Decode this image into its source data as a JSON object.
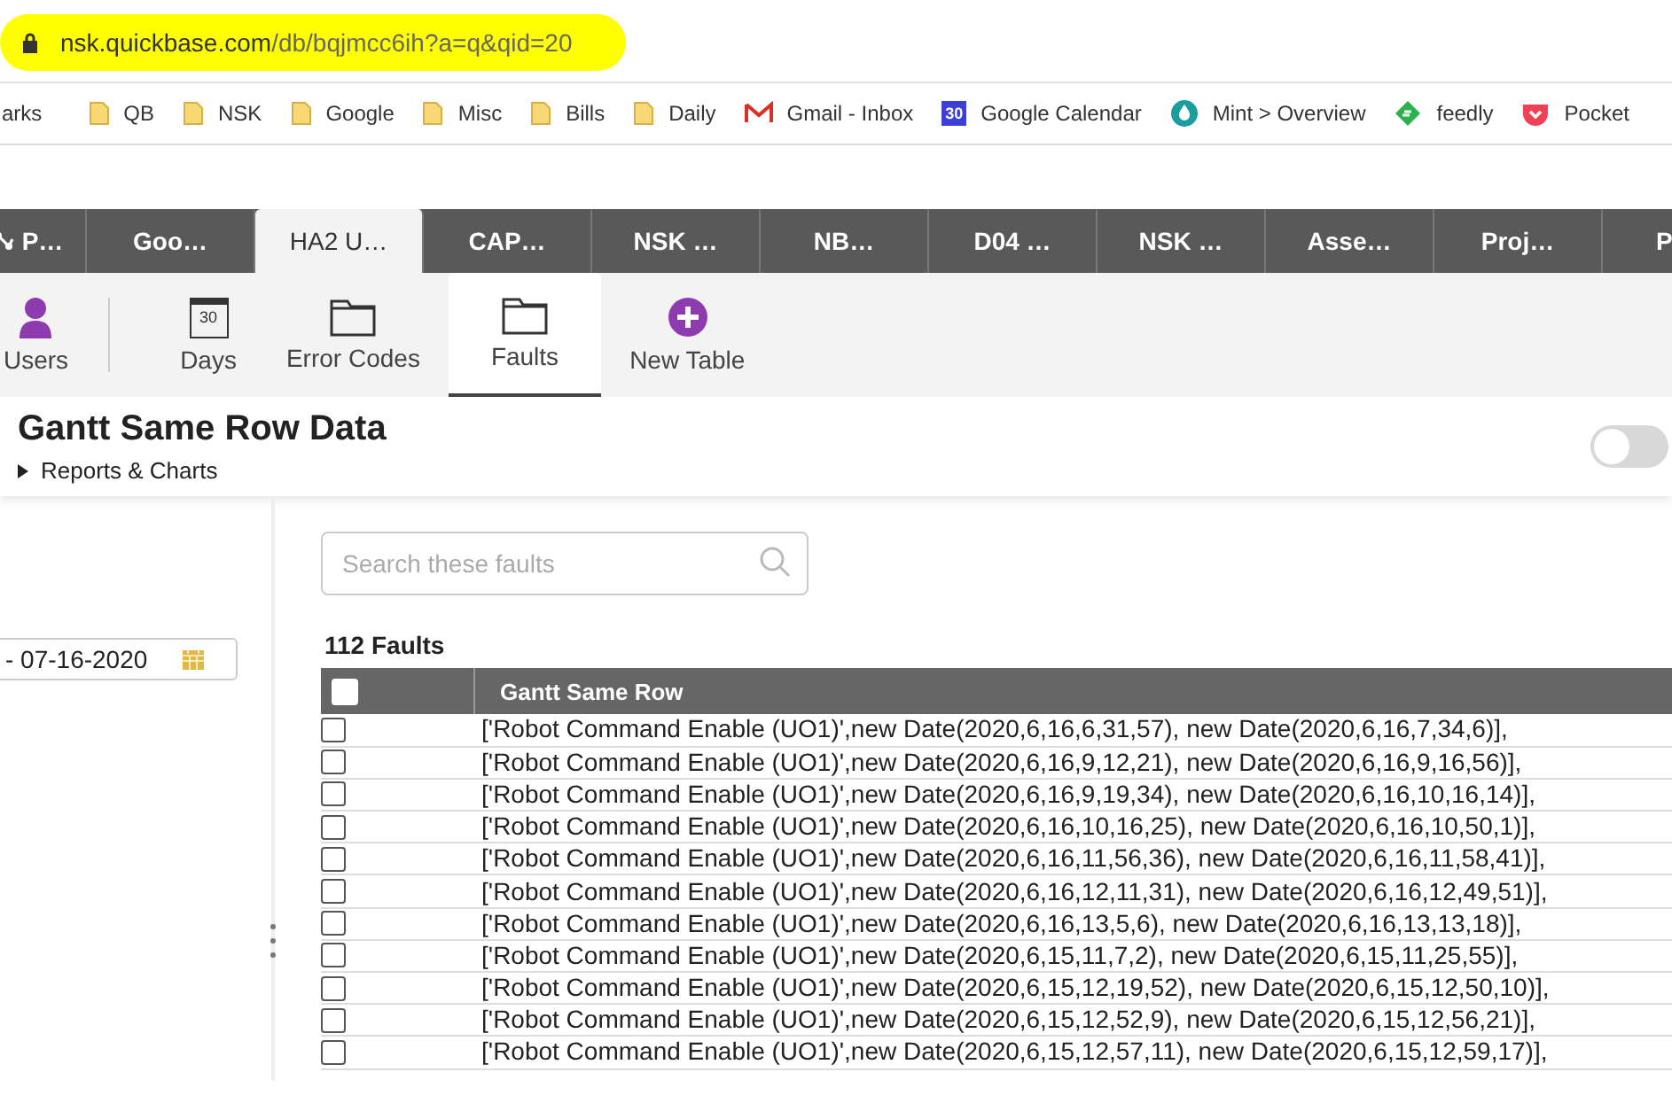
{
  "address_bar": {
    "host": "nsk.quickbase.com",
    "path": "/db/bqjmcc6ih?a=q&qid=20",
    "highlighted": true
  },
  "bookmarks": [
    {
      "label": "arks",
      "kind": "text"
    },
    {
      "label": "QB",
      "kind": "folder"
    },
    {
      "label": "NSK",
      "kind": "folder"
    },
    {
      "label": "Google",
      "kind": "folder"
    },
    {
      "label": "Misc",
      "kind": "folder"
    },
    {
      "label": "Bills",
      "kind": "folder"
    },
    {
      "label": "Daily",
      "kind": "folder"
    },
    {
      "label": "Gmail - Inbox",
      "kind": "mail"
    },
    {
      "label": "Google Calendar",
      "kind": "calendar",
      "icon_text": "30"
    },
    {
      "label": "Mint > Overview",
      "kind": "drop"
    },
    {
      "label": "feedly",
      "kind": "feed"
    },
    {
      "label": "Pocket",
      "kind": "pocket"
    }
  ],
  "app_tabs": [
    {
      "label": "P…",
      "selected": false,
      "kind": "app"
    },
    {
      "label": "Goo…",
      "selected": false
    },
    {
      "label": "HA2 U…",
      "selected": true
    },
    {
      "label": "CAP…",
      "selected": false
    },
    {
      "label": "NSK …",
      "selected": false
    },
    {
      "label": "NB…",
      "selected": false
    },
    {
      "label": "D04 …",
      "selected": false
    },
    {
      "label": "NSK …",
      "selected": false
    },
    {
      "label": "Asse…",
      "selected": false
    },
    {
      "label": "Proj…",
      "selected": false
    },
    {
      "label": "P",
      "selected": false
    }
  ],
  "table_bar": [
    {
      "label": "Users",
      "kind": "user",
      "selected": false
    },
    {
      "label": "Days",
      "kind": "calendar",
      "icon_text": "30",
      "selected": false
    },
    {
      "label": "Error Codes",
      "kind": "folder",
      "selected": false
    },
    {
      "label": "Faults",
      "kind": "folder",
      "selected": true
    },
    {
      "label": "New Table",
      "kind": "add",
      "selected": false
    }
  ],
  "page_header": {
    "title": "Gantt Same Row Data",
    "reports_link": "Reports & Charts",
    "toggle": {
      "on": false
    }
  },
  "filter": {
    "date_value": "- 07-16-2020"
  },
  "search": {
    "placeholder": "Search these faults"
  },
  "record_count": "112 Faults",
  "table": {
    "select_all": {
      "checked": false
    },
    "columns": [
      "Gantt Same Row"
    ],
    "rows": [
      {
        "checked": false,
        "cells": [
          "['Robot Command Enable (UO1)',new Date(2020,6,16,6,31,57), new Date(2020,6,16,7,34,6)],"
        ]
      },
      {
        "checked": false,
        "cells": [
          "['Robot Command Enable (UO1)',new Date(2020,6,16,9,12,21), new Date(2020,6,16,9,16,56)],"
        ]
      },
      {
        "checked": false,
        "cells": [
          "['Robot Command Enable (UO1)',new Date(2020,6,16,9,19,34), new Date(2020,6,16,10,16,14)],"
        ]
      },
      {
        "checked": false,
        "cells": [
          "['Robot Command Enable (UO1)',new Date(2020,6,16,10,16,25), new Date(2020,6,16,10,50,1)],"
        ]
      },
      {
        "checked": false,
        "cells": [
          "['Robot Command Enable (UO1)',new Date(2020,6,16,11,56,36), new Date(2020,6,16,11,58,41)],"
        ]
      },
      {
        "checked": false,
        "cells": [
          "['Robot Command Enable (UO1)',new Date(2020,6,16,12,11,31), new Date(2020,6,16,12,49,51)],"
        ]
      },
      {
        "checked": false,
        "cells": [
          "['Robot Command Enable (UO1)',new Date(2020,6,16,13,5,6), new Date(2020,6,16,13,13,18)],"
        ]
      },
      {
        "checked": false,
        "cells": [
          "['Robot Command Enable (UO1)',new Date(2020,6,15,11,7,2), new Date(2020,6,15,11,25,55)],"
        ]
      },
      {
        "checked": false,
        "cells": [
          "['Robot Command Enable (UO1)',new Date(2020,6,15,12,19,52), new Date(2020,6,15,12,50,10)],"
        ]
      },
      {
        "checked": false,
        "cells": [
          "['Robot Command Enable (UO1)',new Date(2020,6,15,12,52,9), new Date(2020,6,15,12,56,21)],"
        ]
      },
      {
        "checked": false,
        "cells": [
          "['Robot Command Enable (UO1)',new Date(2020,6,15,12,57,11), new Date(2020,6,15,12,59,17)],"
        ]
      }
    ]
  }
}
